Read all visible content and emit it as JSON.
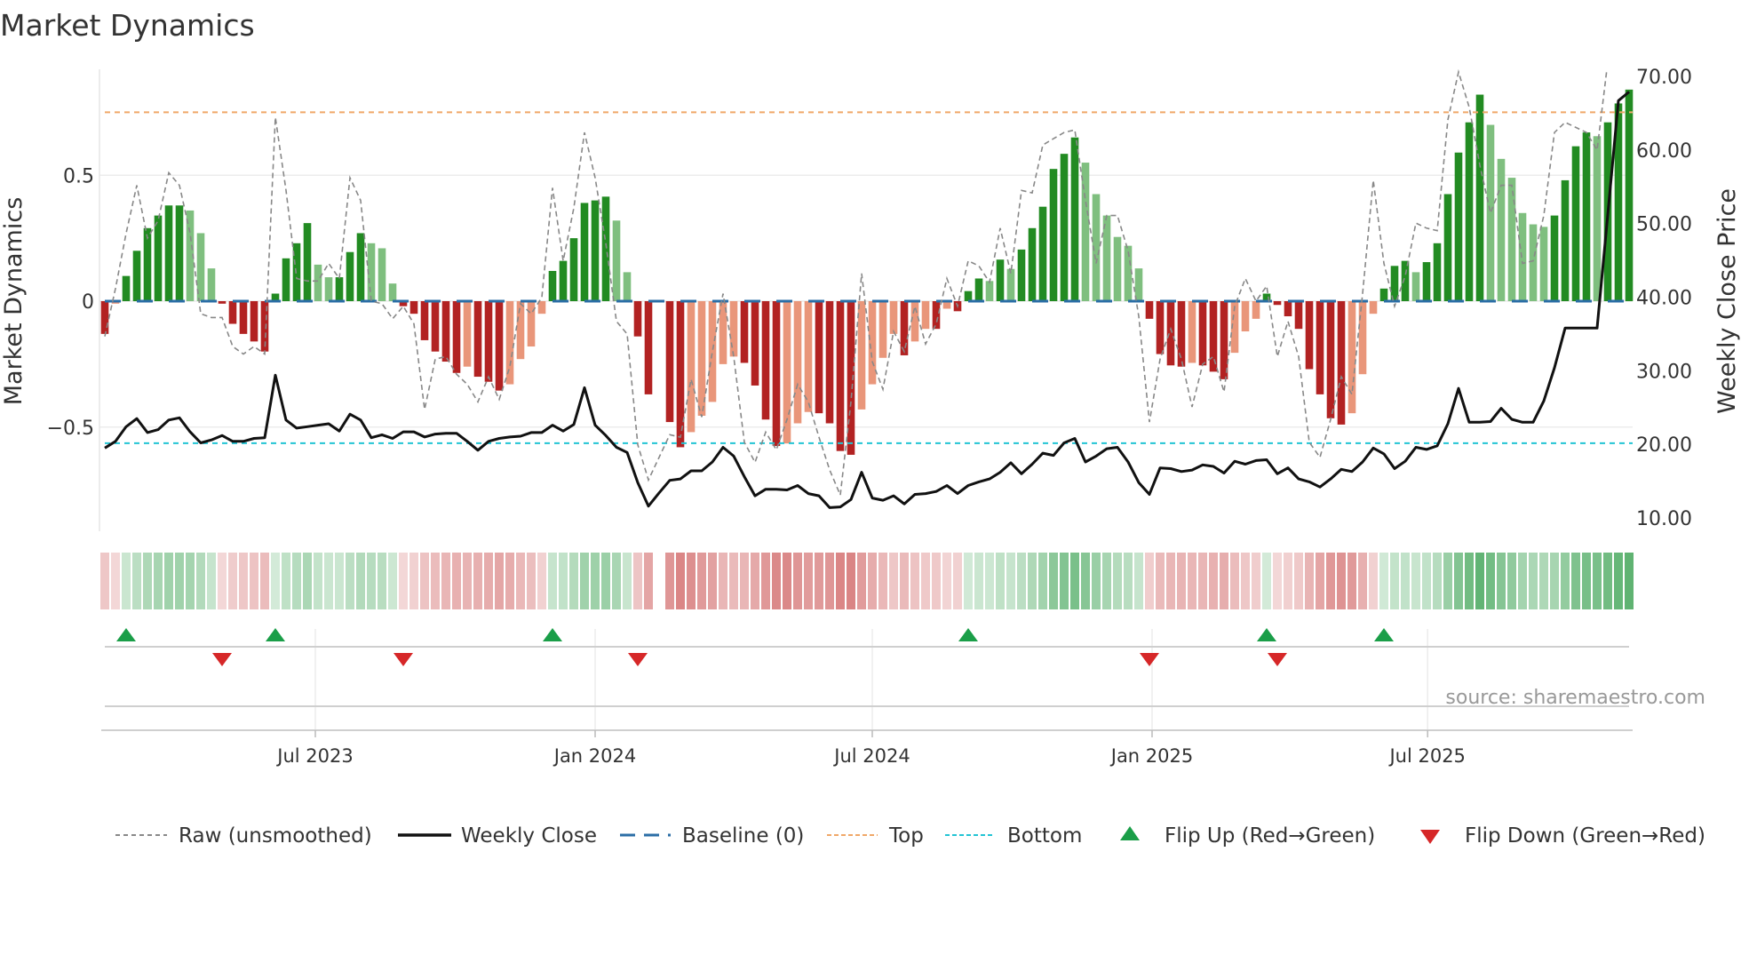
{
  "chart_data": {
    "type": "bar",
    "title": "Market Dynamics",
    "ylabel": "Market Dynamics",
    "y2label": "Weekly Close Price",
    "ylim": [
      -0.83,
      0.92
    ],
    "y2lim": [
      6.5,
      77.5
    ],
    "yticks": [
      {
        "value": 0.5,
        "label": "0.5"
      },
      {
        "value": 0,
        "label": "0"
      },
      {
        "value": -0.5,
        "label": "−0.5"
      }
    ],
    "y2ticks": [
      {
        "value": 70,
        "label": "70.00"
      },
      {
        "value": 60,
        "label": "60.00"
      },
      {
        "value": 50,
        "label": "50.00"
      },
      {
        "value": 40,
        "label": "40.00"
      },
      {
        "value": 30,
        "label": "30.00"
      },
      {
        "value": 20,
        "label": "20.00"
      },
      {
        "value": 10,
        "label": "10.00"
      }
    ],
    "xticks": [
      {
        "week": 19.75,
        "label": "Jul 2023"
      },
      {
        "week": 46,
        "label": "Jan 2024"
      },
      {
        "week": 72,
        "label": "Jul 2024"
      },
      {
        "week": 98.25,
        "label": "Jan 2025"
      },
      {
        "week": 124.1,
        "label": "Jul 2025"
      }
    ],
    "grid": true,
    "top_level": 0.75,
    "bottom_level": -0.564,
    "baseline": 0,
    "colors": {
      "strong_up": "#228b22",
      "weak_up": "#7fbf7f",
      "strong_down": "#b22222",
      "weak_down": "#e9967a",
      "raw": "#888888",
      "close": "#111111",
      "baseline": "#2b6ea6",
      "top": "#f0a868",
      "bottom": "#22c4d4",
      "flip_up": "#1a9e48",
      "flip_down": "#d62728"
    },
    "dynamics": [
      -0.13,
      -0.01,
      0.1,
      0.2,
      0.29,
      0.34,
      0.38,
      0.38,
      0.36,
      0.27,
      0.13,
      -0.01,
      -0.09,
      -0.13,
      -0.16,
      -0.2,
      0.03,
      0.17,
      0.23,
      0.31,
      0.145,
      0.095,
      0.095,
      0.195,
      0.27,
      0.23,
      0.21,
      0.07,
      -0.02,
      -0.05,
      -0.155,
      -0.2,
      -0.24,
      -0.285,
      -0.26,
      -0.3,
      -0.32,
      -0.355,
      -0.33,
      -0.23,
      -0.18,
      -0.05,
      0.12,
      0.16,
      0.25,
      0.39,
      0.4,
      0.415,
      0.32,
      0.115,
      -0.14,
      -0.37,
      null,
      -0.48,
      -0.58,
      -0.52,
      -0.455,
      -0.4,
      -0.25,
      -0.22,
      -0.245,
      -0.335,
      -0.47,
      -0.575,
      -0.565,
      -0.485,
      -0.44,
      -0.445,
      -0.485,
      -0.595,
      -0.61,
      -0.43,
      -0.33,
      -0.225,
      -0.13,
      -0.215,
      -0.16,
      -0.11,
      -0.11,
      -0.03,
      -0.04,
      0.04,
      0.09,
      0.08,
      0.165,
      0.128,
      0.205,
      0.29,
      0.375,
      0.525,
      0.585,
      0.65,
      0.55,
      0.425,
      0.34,
      0.255,
      0.22,
      0.13,
      -0.07,
      -0.21,
      -0.255,
      -0.26,
      -0.245,
      -0.255,
      -0.28,
      -0.31,
      -0.205,
      -0.12,
      -0.07,
      0.03,
      -0.015,
      -0.06,
      -0.11,
      -0.27,
      -0.37,
      -0.465,
      -0.49,
      -0.445,
      -0.29,
      -0.05,
      0.05,
      0.14,
      0.16,
      0.115,
      0.155,
      0.23,
      0.425,
      0.59,
      0.71,
      0.82,
      0.7,
      0.565,
      0.49,
      0.35,
      0.305,
      0.295,
      0.34,
      0.48,
      0.615,
      0.67,
      0.655,
      0.71,
      0.785,
      0.84
    ],
    "raw": [
      -0.14,
      0.05,
      0.27,
      0.46,
      0.25,
      0.32,
      0.51,
      0.46,
      0.27,
      -0.05,
      -0.065,
      -0.065,
      -0.18,
      -0.21,
      -0.18,
      -0.21,
      0.73,
      0.44,
      0.09,
      0.08,
      0.08,
      0.15,
      0.09,
      0.49,
      0.4,
      0,
      -0.01,
      -0.07,
      -0.02,
      -0.09,
      -0.43,
      -0.23,
      -0.22,
      -0.29,
      -0.33,
      -0.4,
      -0.3,
      -0.39,
      -0.26,
      -0.01,
      -0.05,
      0.015,
      0.45,
      0.16,
      0.37,
      0.67,
      0.49,
      0.23,
      -0.08,
      -0.13,
      -0.57,
      -0.71,
      -0.62,
      -0.53,
      -0.54,
      -0.31,
      -0.46,
      -0.2,
      0.03,
      -0.22,
      -0.56,
      -0.64,
      -0.52,
      -0.59,
      -0.47,
      -0.33,
      -0.4,
      -0.54,
      -0.67,
      -0.77,
      -0.4,
      0.11,
      -0.24,
      -0.35,
      -0.12,
      -0.2,
      -0.02,
      -0.17,
      -0.09,
      0.09,
      -0.02,
      0.16,
      0.14,
      0.075,
      0.29,
      0.11,
      0.44,
      0.43,
      0.62,
      0.645,
      0.67,
      0.68,
      0.4,
      0.15,
      0.34,
      0.34,
      0.2,
      -0.06,
      -0.48,
      -0.23,
      -0.11,
      -0.23,
      -0.42,
      -0.25,
      -0.22,
      -0.36,
      -0.02,
      0.09,
      0,
      0.06,
      -0.22,
      -0.08,
      -0.22,
      -0.56,
      -0.62,
      -0.47,
      -0.3,
      -0.37,
      0.03,
      0.48,
      0.15,
      -0.02,
      0.1,
      0.31,
      0.29,
      0.28,
      0.72,
      0.91,
      0.77,
      0.54,
      0.35,
      0.46,
      0.46,
      0.15,
      0.16,
      0.34,
      0.67,
      0.71,
      0.69,
      0.67,
      0.6,
      0.95,
      1.05,
      1.1
    ],
    "weekly_close": [
      19.5,
      20.4,
      22.4,
      23.5,
      21.6,
      22.0,
      23.3,
      23.6,
      21.7,
      20.2,
      20.6,
      21.2,
      20.4,
      20.4,
      20.8,
      20.9,
      29.4,
      23.3,
      22.2,
      22.4,
      22.6,
      22.8,
      21.8,
      24.1,
      23.3,
      20.9,
      21.3,
      20.8,
      21.7,
      21.7,
      21.0,
      21.4,
      21.5,
      21.5,
      20.4,
      19.2,
      20.4,
      20.8,
      21.0,
      21.1,
      21.6,
      21.6,
      22.6,
      21.8,
      22.7,
      27.7,
      22.6,
      21.2,
      19.6,
      18.9,
      14.8,
      11.6,
      13.4,
      15.1,
      15.3,
      16.4,
      16.4,
      17.6,
      19.6,
      18.4,
      15.6,
      13.0,
      13.9,
      13.9,
      13.8,
      14.4,
      13.3,
      13.0,
      11.4,
      11.5,
      12.5,
      16.2,
      12.7,
      12.4,
      13.0,
      11.9,
      13.2,
      13.3,
      13.6,
      14.4,
      13.3,
      14.4,
      14.9,
      15.3,
      16.2,
      17.5,
      16.0,
      17.3,
      18.8,
      18.5,
      20.2,
      20.8,
      17.6,
      18.4,
      19.4,
      19.6,
      17.6,
      14.8,
      13.2,
      16.8,
      16.7,
      16.3,
      16.5,
      17.2,
      17.0,
      16.1,
      17.7,
      17.3,
      17.8,
      17.9,
      16.0,
      16.8,
      15.3,
      14.9,
      14.2,
      15.3,
      16.6,
      16.3,
      17.6,
      19.5,
      18.7,
      16.7,
      17.7,
      19.6,
      19.3,
      19.8,
      22.8,
      27.6,
      23.0,
      23.0,
      23.1,
      24.9,
      23.4,
      23.0,
      23.0,
      25.9,
      30.4,
      35.8,
      35.8,
      35.8,
      35.8,
      51.2,
      66.7,
      67.9
    ],
    "flip_up_weeks": [
      2,
      16,
      42,
      81,
      109,
      120
    ],
    "flip_down_weeks": [
      11,
      28,
      50,
      98,
      110
    ],
    "legend": {
      "position": "bottom",
      "items": [
        "Raw (unsmoothed)",
        "Weekly Close",
        "Baseline (0)",
        "Top",
        "Bottom",
        "Flip Up (Red→Green)",
        "Flip Down (Green→Red)"
      ]
    },
    "source": "source: sharemaestro.com"
  }
}
